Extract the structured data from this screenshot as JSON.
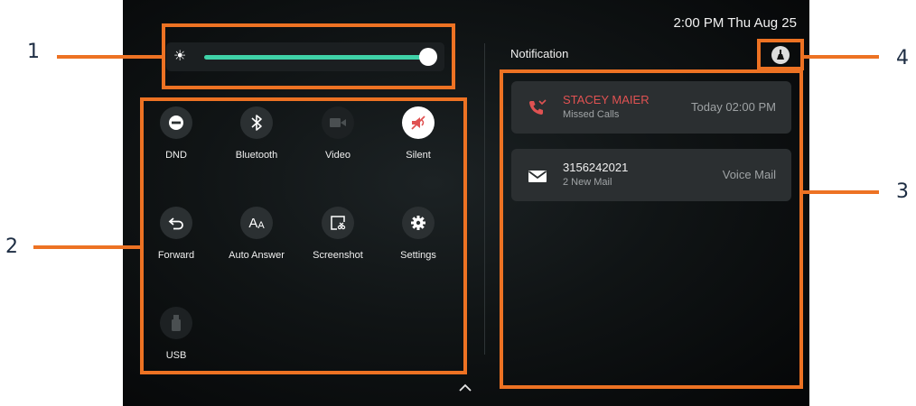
{
  "status_bar": {
    "datetime": "2:00 PM Thu Aug 25"
  },
  "brightness": {
    "level_fraction": 1.0,
    "icon": "sun-icon",
    "accent_color": "#3fd2a8"
  },
  "quick_settings": [
    {
      "label": "DND",
      "icon": "dnd-icon",
      "state": "available"
    },
    {
      "label": "Bluetooth",
      "icon": "bluetooth-icon",
      "state": "available"
    },
    {
      "label": "Video",
      "icon": "video-icon",
      "state": "disabled"
    },
    {
      "label": "Silent",
      "icon": "silent-icon",
      "state": "active"
    },
    {
      "label": "Forward",
      "icon": "forward-icon",
      "state": "available"
    },
    {
      "label": "Auto Answer",
      "icon": "auto-answer-icon",
      "state": "available"
    },
    {
      "label": "Screenshot",
      "icon": "screenshot-icon",
      "state": "available"
    },
    {
      "label": "Settings",
      "icon": "gear-icon",
      "state": "available"
    },
    {
      "label": "USB",
      "icon": "usb-icon",
      "state": "disabled"
    }
  ],
  "notifications": {
    "title": "Notification",
    "clear_icon": "broom-icon",
    "items": [
      {
        "name": "STACEY MAIER",
        "detail": "Missed Calls",
        "meta": "Today 02:00 PM",
        "icon": "missed-call-icon",
        "name_color": "#e05252"
      },
      {
        "name": "3156242021",
        "detail": "2  New Mail",
        "meta": "Voice Mail",
        "icon": "mail-icon",
        "name_color": "#f0f0f0"
      }
    ]
  },
  "callouts": {
    "c1": "1",
    "c2": "2",
    "c3": "3",
    "c4": "4",
    "color": "#ed7223"
  }
}
